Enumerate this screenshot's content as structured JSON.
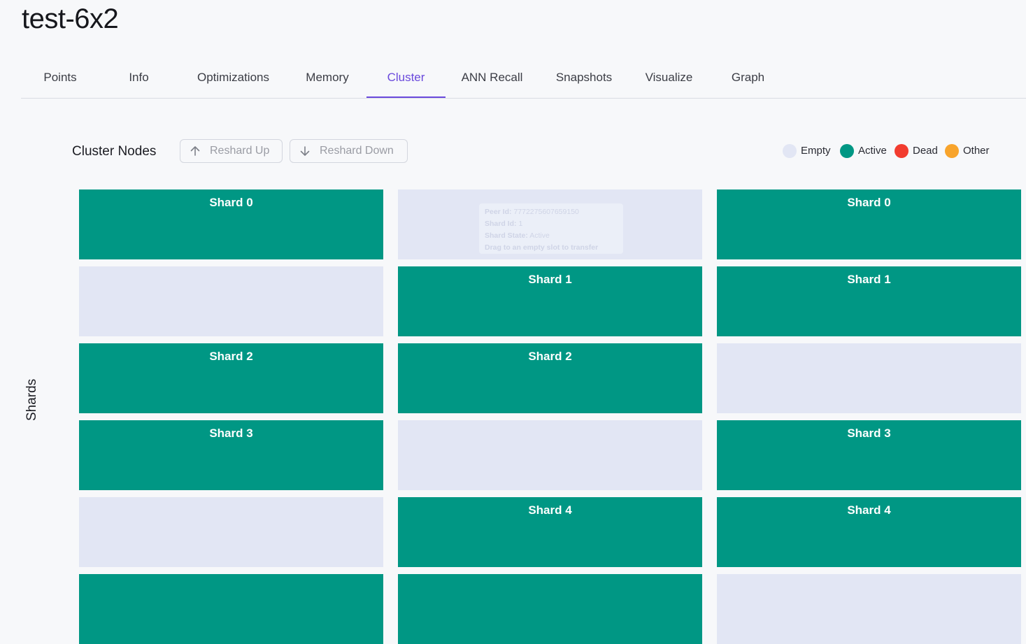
{
  "page": {
    "title": "test-6x2"
  },
  "tabs": [
    {
      "label": "Points",
      "active": false
    },
    {
      "label": "Info",
      "active": false
    },
    {
      "label": "Optimizations",
      "active": false
    },
    {
      "label": "Memory",
      "active": false
    },
    {
      "label": "Cluster",
      "active": true
    },
    {
      "label": "ANN Recall",
      "active": false
    },
    {
      "label": "Snapshots",
      "active": false
    },
    {
      "label": "Visualize",
      "active": false
    },
    {
      "label": "Graph",
      "active": false
    }
  ],
  "cluster": {
    "heading": "Cluster Nodes",
    "reshard_up_label": "Reshard Up",
    "reshard_down_label": "Reshard Down",
    "y_axis_label": "Shards"
  },
  "legend": [
    {
      "label": "Empty",
      "color": "#e2e6f4"
    },
    {
      "label": "Active",
      "color": "#009784"
    },
    {
      "label": "Dead",
      "color": "#f23c2f"
    },
    {
      "label": "Other",
      "color": "#f8a42c"
    }
  ],
  "drag_tooltip": {
    "peer_label": "Peer Id:",
    "peer_value": "7772275607659150",
    "shard_label": "Shard Id:",
    "shard_value": "1",
    "state_label": "Shard State:",
    "state_value": "Active",
    "hint": "Drag to an empty slot to transfer"
  },
  "shard_grid": {
    "columns": 3,
    "rows": [
      [
        {
          "state": "active",
          "label": "Shard 0"
        },
        {
          "state": "empty",
          "label": "",
          "ghost": true
        },
        {
          "state": "active",
          "label": "Shard 0"
        }
      ],
      [
        {
          "state": "empty",
          "label": ""
        },
        {
          "state": "active",
          "label": "Shard 1"
        },
        {
          "state": "active",
          "label": "Shard 1"
        }
      ],
      [
        {
          "state": "active",
          "label": "Shard 2"
        },
        {
          "state": "active",
          "label": "Shard 2"
        },
        {
          "state": "empty",
          "label": ""
        }
      ],
      [
        {
          "state": "active",
          "label": "Shard 3"
        },
        {
          "state": "empty",
          "label": ""
        },
        {
          "state": "active",
          "label": "Shard 3"
        }
      ],
      [
        {
          "state": "empty",
          "label": ""
        },
        {
          "state": "active",
          "label": "Shard 4"
        },
        {
          "state": "active",
          "label": "Shard 4"
        }
      ],
      [
        {
          "state": "active",
          "label": ""
        },
        {
          "state": "active",
          "label": ""
        },
        {
          "state": "empty",
          "label": ""
        }
      ]
    ]
  }
}
